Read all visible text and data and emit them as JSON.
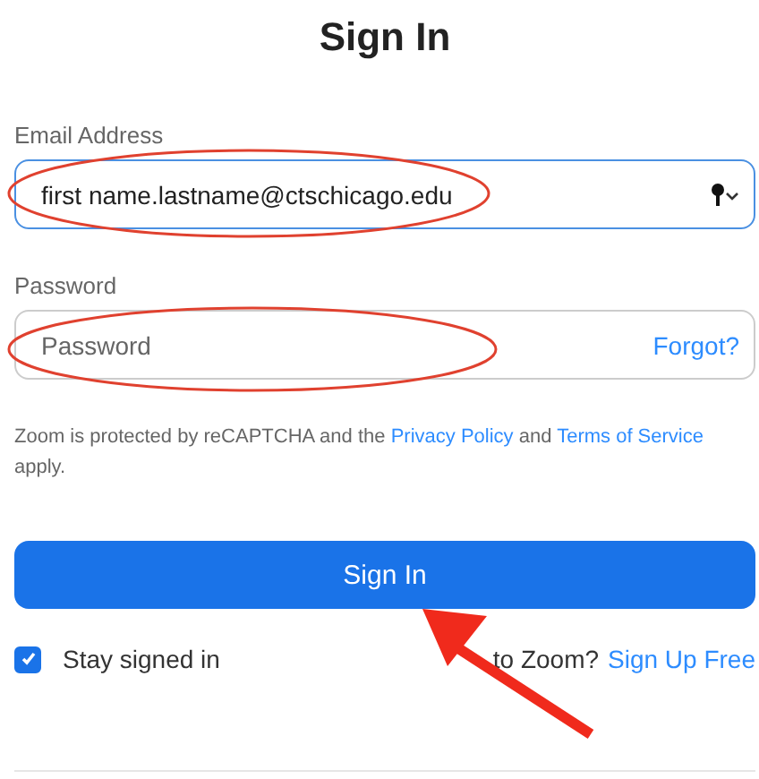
{
  "title": "Sign In",
  "email": {
    "label": "Email Address",
    "value": "first name.lastname@ctschicago.edu"
  },
  "password": {
    "label": "Password",
    "placeholder": "Password",
    "forgot": "Forgot?"
  },
  "notice": {
    "text": "Zoom is protected by reCAPTCHA and the",
    "privacy": "Privacy Policy",
    "and": "and",
    "terms": "Terms of Service",
    "end": "apply."
  },
  "sign_in_button": "Sign In",
  "stay_signed_in": {
    "label": "Stay signed in",
    "checked": true
  },
  "signup": {
    "question": "to Zoom?",
    "link": "Sign Up Free"
  }
}
